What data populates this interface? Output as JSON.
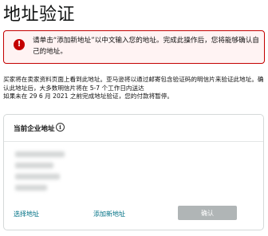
{
  "page": {
    "title": "地址验证"
  },
  "alert": {
    "icon": "!",
    "message": "请单击“添加新地址”以中文输入您的地址。完成此操作后，您将能够确认自己的地址。",
    "color": "#c40000"
  },
  "info": {
    "line1": "买家将在卖家资料页面上看到此地址。亚马逊将以通过邮寄包含验证码的明信片来验证此地址。确认此地址后，大多数明信片将在 5-7 个工作日内送达",
    "line2": "如果未在 29 6 月 2021 之前完成地址验证，您的付款将暂停。"
  },
  "address_card": {
    "title": "当前企业地址",
    "info_icon": "i",
    "select_link": "选择地址",
    "add_link": "添加新地址",
    "confirm_button": "确认"
  },
  "colors": {
    "link": "#007185",
    "button_disabled": "#b0b5b6",
    "alert_border": "#c40000"
  }
}
